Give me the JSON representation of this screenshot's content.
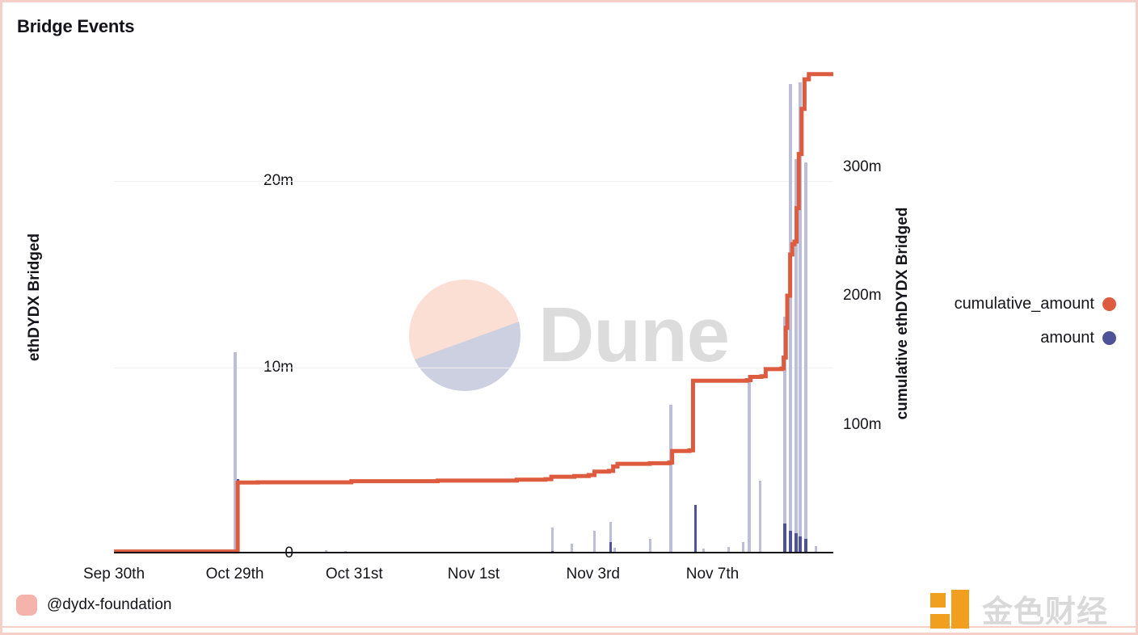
{
  "chart_title": "Bridge Events",
  "colors": {
    "cumulative_line": "#dd5b3e",
    "amount_bar": "#4e5399",
    "amount_bar_light": "#b9bcd8",
    "card_border": "#f6cfc9",
    "grid": "#f0f0f2",
    "axis": "#15141a",
    "avatar": "#f4b4ac",
    "dune_top": "#fbdfd4",
    "dune_bottom": "#ccd0e0",
    "watermark_text": "#dcdcdc",
    "jinse_orange": "#f0a01e",
    "jinse_text": "#d9d9d9"
  },
  "footer": {
    "author": "@dydx-foundation"
  },
  "watermarks": {
    "dune_label": "Dune",
    "jinse_label": "金色财经"
  },
  "legend": [
    {
      "label": "cumulative_amount",
      "color": "#dd5b3e",
      "name": "cumulative-amount"
    },
    {
      "label": "amount",
      "color": "#4e5399",
      "name": "amount"
    }
  ],
  "chart_data": {
    "type": "bar",
    "title": "Bridge Events",
    "xlabel": "",
    "ylabel": "ethDYDX Bridged",
    "y2label": "cumulative ethDYDX Bridged",
    "grid": true,
    "legend_position": "right",
    "ylim": [
      0,
      27000000
    ],
    "y2lim": [
      0,
      390000000
    ],
    "yticks": [
      0,
      10000000,
      20000000
    ],
    "ytick_labels": [
      "0",
      "10m",
      "20m"
    ],
    "y2ticks": [
      100000000,
      200000000,
      300000000
    ],
    "y2tick_labels": [
      "100m",
      "200m",
      "300m"
    ],
    "xtick_labels": [
      "Sep 30th",
      "Oct 29th",
      "Oct 31st",
      "Nov 1st",
      "Nov 3rd",
      "Nov 7th"
    ],
    "xtick_positions": [
      0.0,
      0.168,
      0.334,
      0.5,
      0.666,
      0.832
    ],
    "series": [
      {
        "name": "amount",
        "type": "bar",
        "axis": "left",
        "color": "#4e5399",
        "values": [
          {
            "x": 0.169,
            "y": 10800000,
            "dark": 0
          },
          {
            "x": 0.172,
            "y": 4000000,
            "dark": 4000000
          },
          {
            "x": 0.295,
            "y": 180000,
            "dark": 0
          },
          {
            "x": 0.322,
            "y": 120000,
            "dark": 0
          },
          {
            "x": 0.61,
            "y": 1400000,
            "dark": 120000
          },
          {
            "x": 0.637,
            "y": 500000,
            "dark": 0
          },
          {
            "x": 0.668,
            "y": 1200000,
            "dark": 0
          },
          {
            "x": 0.69,
            "y": 1700000,
            "dark": 600000
          },
          {
            "x": 0.696,
            "y": 320000,
            "dark": 0
          },
          {
            "x": 0.745,
            "y": 800000,
            "dark": 0
          },
          {
            "x": 0.774,
            "y": 8000000,
            "dark": 0
          },
          {
            "x": 0.808,
            "y": 2600000,
            "dark": 2600000
          },
          {
            "x": 0.82,
            "y": 250000,
            "dark": 0
          },
          {
            "x": 0.855,
            "y": 350000,
            "dark": 0
          },
          {
            "x": 0.875,
            "y": 600000,
            "dark": 0
          },
          {
            "x": 0.883,
            "y": 9600000,
            "dark": 0
          },
          {
            "x": 0.898,
            "y": 3900000,
            "dark": 0
          },
          {
            "x": 0.933,
            "y": 12700000,
            "dark": 1600000
          },
          {
            "x": 0.941,
            "y": 25200000,
            "dark": 1200000
          },
          {
            "x": 0.948,
            "y": 21200000,
            "dark": 1100000
          },
          {
            "x": 0.954,
            "y": 25300000,
            "dark": 900000
          },
          {
            "x": 0.962,
            "y": 21000000,
            "dark": 800000
          },
          {
            "x": 0.976,
            "y": 380000,
            "dark": 0
          }
        ]
      },
      {
        "name": "cumulative_amount",
        "type": "line",
        "axis": "right",
        "color": "#dd5b3e",
        "points": [
          {
            "x": 0.0,
            "y": 1500000
          },
          {
            "x": 0.16,
            "y": 1500000
          },
          {
            "x": 0.168,
            "y": 1500000
          },
          {
            "x": 0.172,
            "y": 55000000
          },
          {
            "x": 0.2,
            "y": 55200000
          },
          {
            "x": 0.33,
            "y": 56000000
          },
          {
            "x": 0.45,
            "y": 56500000
          },
          {
            "x": 0.56,
            "y": 57200000
          },
          {
            "x": 0.6,
            "y": 57600000
          },
          {
            "x": 0.608,
            "y": 59500000
          },
          {
            "x": 0.64,
            "y": 60000000
          },
          {
            "x": 0.66,
            "y": 60800000
          },
          {
            "x": 0.668,
            "y": 63500000
          },
          {
            "x": 0.688,
            "y": 64000000
          },
          {
            "x": 0.694,
            "y": 67500000
          },
          {
            "x": 0.7,
            "y": 69500000
          },
          {
            "x": 0.745,
            "y": 70000000
          },
          {
            "x": 0.772,
            "y": 70500000
          },
          {
            "x": 0.776,
            "y": 79500000
          },
          {
            "x": 0.8,
            "y": 80000000
          },
          {
            "x": 0.805,
            "y": 134000000
          },
          {
            "x": 0.88,
            "y": 134500000
          },
          {
            "x": 0.885,
            "y": 137000000
          },
          {
            "x": 0.9,
            "y": 137500000
          },
          {
            "x": 0.906,
            "y": 143000000
          },
          {
            "x": 0.928,
            "y": 143500000
          },
          {
            "x": 0.931,
            "y": 152000000
          },
          {
            "x": 0.934,
            "y": 175000000
          },
          {
            "x": 0.936,
            "y": 200000000
          },
          {
            "x": 0.94,
            "y": 232000000
          },
          {
            "x": 0.943,
            "y": 240000000
          },
          {
            "x": 0.946,
            "y": 242000000
          },
          {
            "x": 0.949,
            "y": 268000000
          },
          {
            "x": 0.952,
            "y": 310000000
          },
          {
            "x": 0.956,
            "y": 345000000
          },
          {
            "x": 0.96,
            "y": 368000000
          },
          {
            "x": 0.966,
            "y": 372000000
          },
          {
            "x": 1.0,
            "y": 372000000
          }
        ]
      }
    ]
  }
}
